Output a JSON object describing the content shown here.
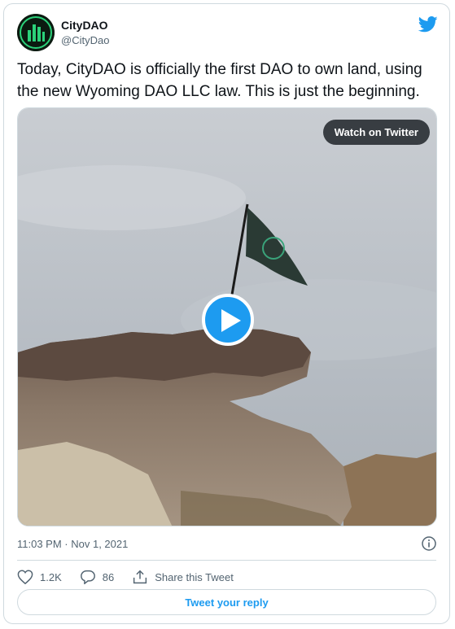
{
  "author": {
    "name": "CityDAO",
    "handle": "@CityDao",
    "avatar_icon": "citydao-logo-icon"
  },
  "brand_icon": "twitter-bird-icon",
  "tweet_text": "Today, CityDAO is officially the first DAO to own land, using the new Wyoming DAO LLC law. This is just the beginning.",
  "media": {
    "watch_label": "Watch on Twitter",
    "play_icon": "play-icon"
  },
  "timestamp": "11:03 PM · Nov 1, 2021",
  "info_icon": "info-icon",
  "actions": {
    "like_icon": "heart-icon",
    "likes": "1.2K",
    "reply_icon": "reply-bubble-icon",
    "replies": "86",
    "share_icon": "share-icon",
    "share_label": "Share this Tweet"
  },
  "reply_button": "Tweet your reply",
  "colors": {
    "accent": "#1d9bf0",
    "text_primary": "#0f1419",
    "text_secondary": "#536471",
    "border": "#cfd9de"
  }
}
